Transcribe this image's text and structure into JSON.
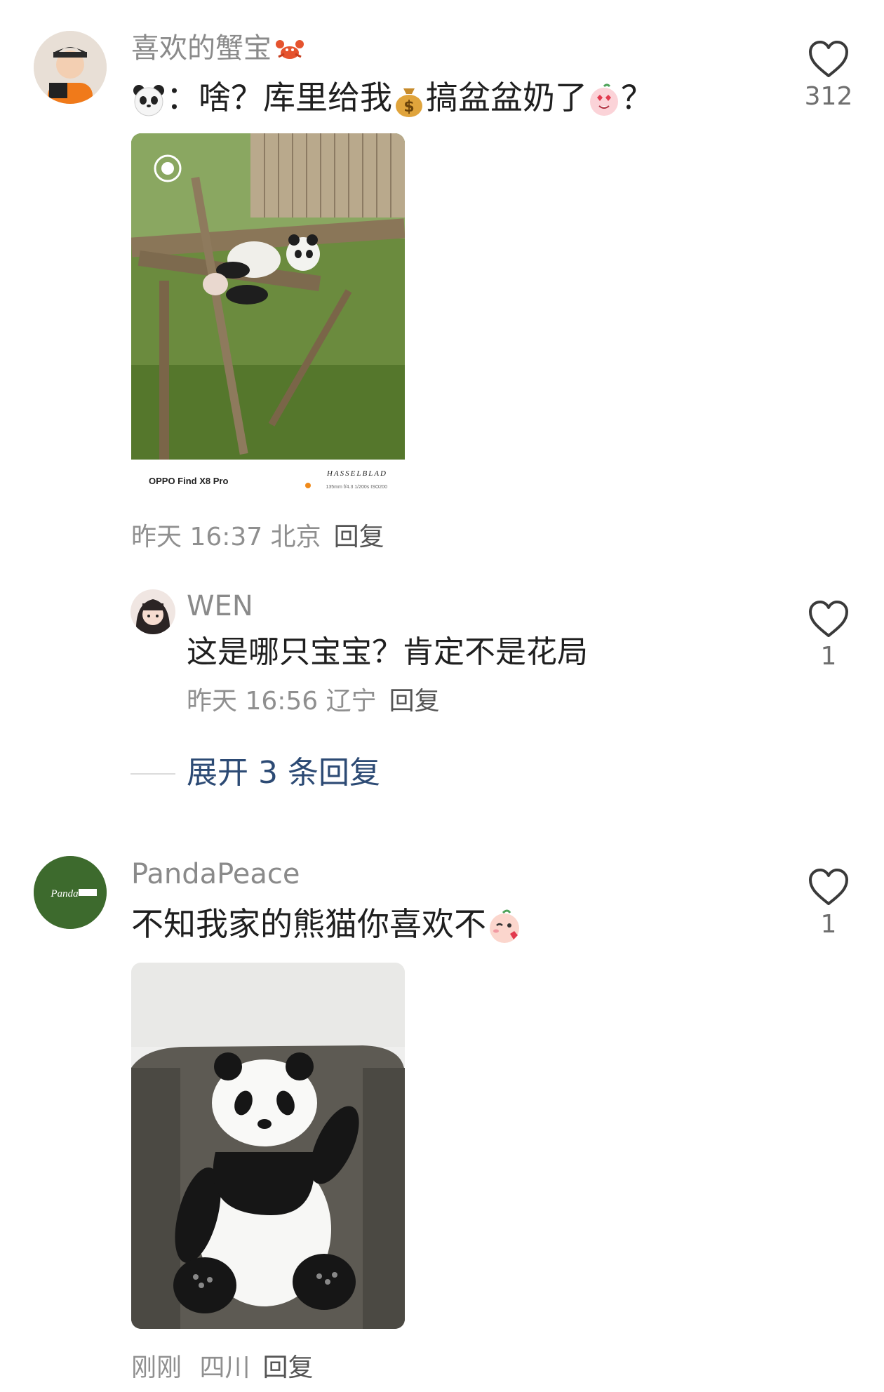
{
  "comments": [
    {
      "username": "喜欢的蟹宝",
      "username_emoji": "crab-emoji",
      "text_prefix_emoji": "panda-face-emoji",
      "text_part1": "：啥？库里给我",
      "text_emoji1": "money-bag-emoji",
      "text_part2": "搞盆盆奶了",
      "text_emoji2": "heart-eyes-emoji",
      "text_part3": "？",
      "image": {
        "type": "photo",
        "subject": "panda-on-log",
        "caption_left": "OPPO Find X8 Pro",
        "caption_right": "HASSELBLAD",
        "caption_sub": "135mm f/4.3 1/200s ISO200"
      },
      "time": "昨天 16:37",
      "location": "北京",
      "reply_label": "回复",
      "likes": "312"
    },
    {
      "username": "WEN",
      "text": "这是哪只宝宝？肯定不是花局",
      "time": "昨天 16:56",
      "location": "辽宁",
      "reply_label": "回复",
      "likes": "1"
    },
    {
      "username": "PandaPeace",
      "avatar_text": "Panda",
      "avatar_color": "#3d6a2d",
      "text": "不知我家的熊猫你喜欢不",
      "text_emoji": "blushing-emoji",
      "time": "刚刚",
      "location": "四川",
      "reply_label": "回复",
      "likes": "1"
    }
  ],
  "expand_replies": "展开 3 条回复"
}
